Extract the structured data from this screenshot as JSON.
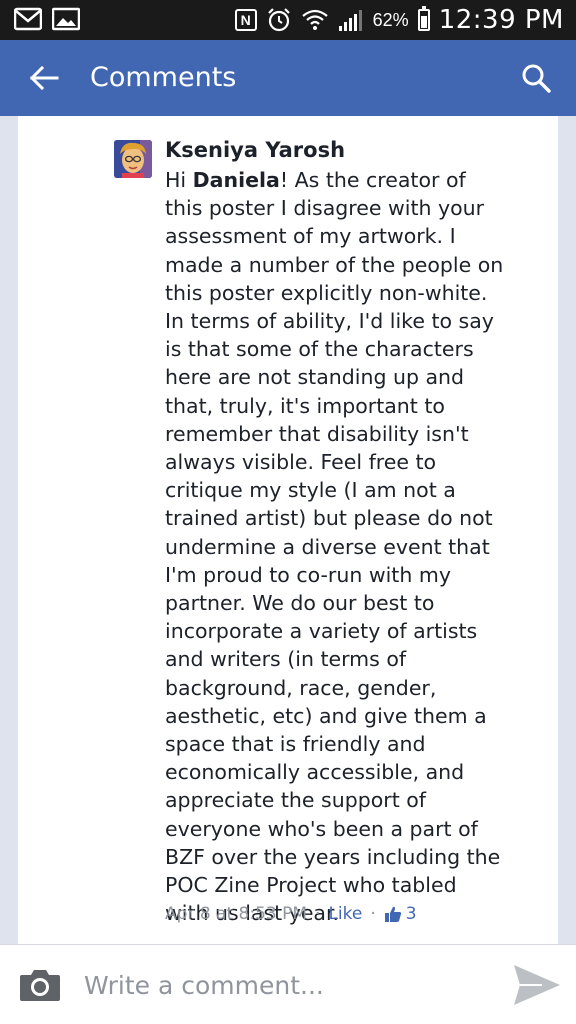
{
  "status_bar": {
    "battery_percent": "62%",
    "time": "12:39 PM",
    "icons": [
      "gmail-icon",
      "gallery-icon",
      "nfc-icon",
      "alarm-icon",
      "wifi-icon",
      "signal-icon",
      "battery-icon"
    ]
  },
  "header": {
    "title": "Comments",
    "back_icon": "arrow-left-icon",
    "search_icon": "search-icon"
  },
  "comment": {
    "author": "Kseniya Yarosh",
    "body_prefix": "Hi ",
    "body_mention": "Daniela",
    "body_text": "! As the creator of this poster I disagree with your assessment of my artwork. I made a number of the people on this poster explicitly non-white. In terms of ability, I'd like to say is that some of the characters here are not standing up and that, truly, it's important to remember that disability isn't always visible. Feel free to critique my style (I am not a trained artist) but please do not undermine a diverse event that I'm proud to co-run with my partner. We do our best to incorporate a variety of artists and writers (in terms of background, race, gender, aesthetic, etc) and give them a space that is friendly and economically accessible, and appreciate the support of everyone who's been a part of BZF over the years including the POC Zine Project who tabled with us last year.",
    "timestamp": "Apr 8 at 8:53 PM",
    "separator": "·",
    "like_label": "Like",
    "like_count": "3"
  },
  "composer": {
    "placeholder": "Write a comment...",
    "camera_icon": "camera-icon",
    "send_icon": "send-icon"
  },
  "colors": {
    "brand": "#4267b2",
    "status_bar": "#1a1a1a",
    "background": "#dfe3ee",
    "meta_text": "#90949c"
  }
}
